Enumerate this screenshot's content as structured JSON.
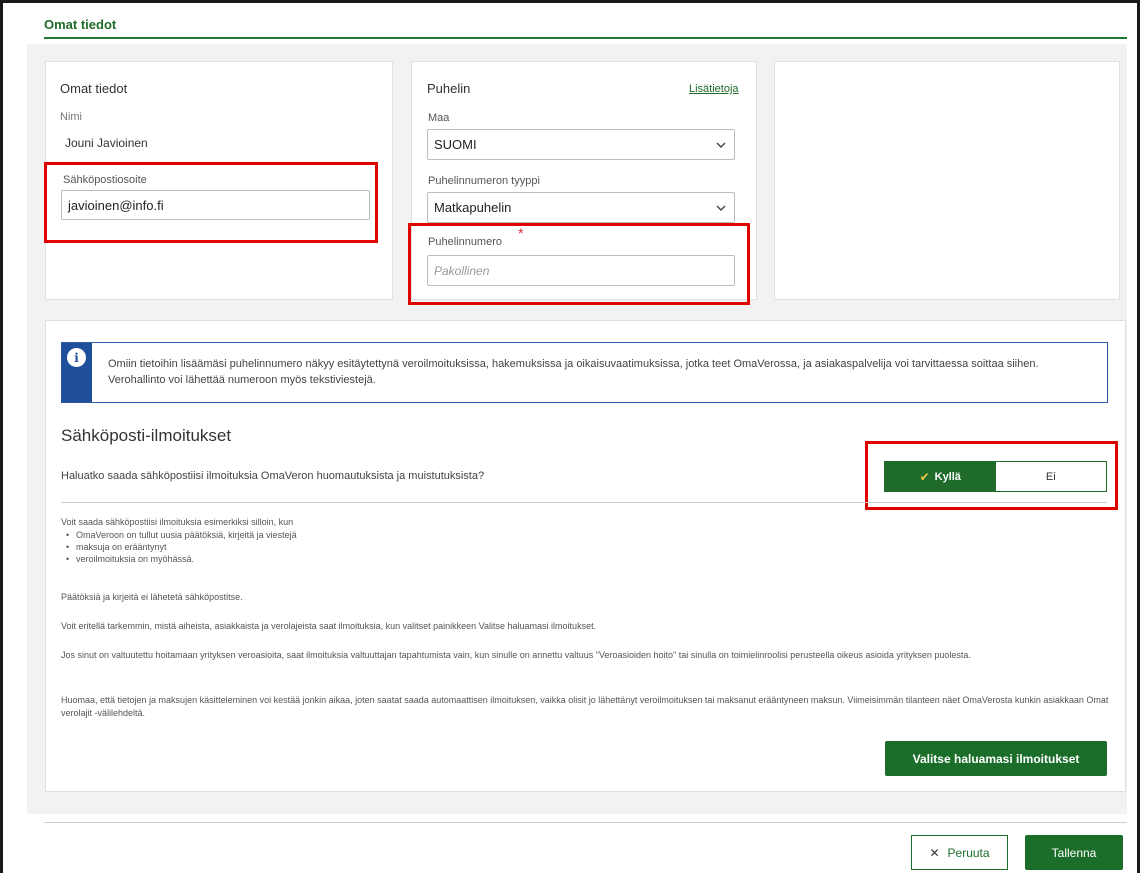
{
  "page": {
    "tab_title": "Omat tiedot"
  },
  "personal": {
    "title": "Omat tiedot",
    "name_label": "Nimi",
    "name_value": "Jouni Javioinen",
    "email_label": "Sähköpostiosoite",
    "email_value": "javioinen@info.fi"
  },
  "phone": {
    "title": "Puhelin",
    "more_link": "Lisätietoja",
    "country_label": "Maa",
    "country_value": "SUOMI",
    "type_label": "Puhelinnumeron tyyppi",
    "type_value": "Matkapuhelin",
    "number_label": "Puhelinnumero",
    "required_mark": "*",
    "number_placeholder": "Pakollinen"
  },
  "info": {
    "icon": "info-icon",
    "text": "Omiin tietoihin lisäämäsi puhelinnumero näkyy esitäytettynä veroilmoituksissa, hakemuksissa ja oikaisuvaatimuksissa, jotka teet OmaVerossa, ja asiakaspalvelija voi tarvittaessa soittaa siihen. Verohallinto voi lähettää numeroon myös tekstiviestejä."
  },
  "notifications": {
    "heading": "Sähköposti-ilmoitukset",
    "question": "Haluatko saada sähköpostiisi ilmoituksia OmaVeron huomautuksista ja muistutuksista?",
    "toggle_yes": "Kyllä",
    "toggle_no": "Ei",
    "intro": "Voit saada sähköpostiisi ilmoituksia esimerkiksi silloin, kun",
    "bullets": [
      "OmaVeroon on tullut uusia päätöksiä, kirjeitä ja viestejä",
      "maksuja on erääntynyt",
      "veroilmoituksia on myöhässä."
    ],
    "para1": "Päätöksiä ja kirjeitä ei lähetetä sähköpostitse.",
    "para2": "Voit eritellä tarkemmin, mistä aiheista, asiakkaista ja verolajeista saat ilmoituksia, kun valitset painikkeen Valitse haluamasi ilmoitukset.",
    "para3": "Jos sinut on valtuutettu hoitamaan yrityksen veroasioita, saat ilmoituksia valtuuttajan tapahtumista vain, kun sinulle on annettu valtuus \"Veroasioiden hoito\" tai sinulla on toimielinroolisi perusteella oikeus asioida yrityksen puolesta.",
    "para4": "Huomaa, että tietojen ja maksujen käsitteleminen voi kestää jonkin aikaa, joten saatat saada automaattisen ilmoituksen, vaikka olisit jo lähettänyt veroilmoituksen tai maksanut erääntyneen maksun. Viimeisimmän tilanteen näet OmaVerosta kunkin asiakkaan Omat verolajit -välilehdeltä.",
    "choose_button": "Valitse haluamasi ilmoitukset"
  },
  "footer": {
    "cancel_label": "Peruuta",
    "save_label": "Tallenna"
  },
  "colors": {
    "brand_green": "#1a6e2a",
    "info_blue": "#1f4f9a",
    "highlight_red": "#e00000"
  }
}
